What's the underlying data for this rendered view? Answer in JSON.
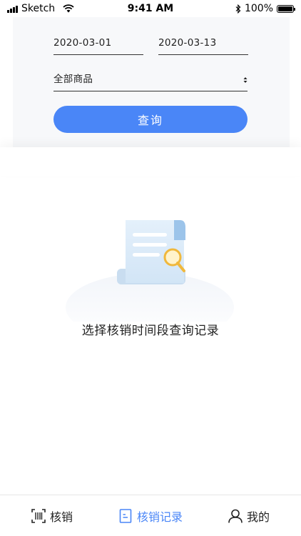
{
  "status_bar": {
    "carrier": "Sketch",
    "time": "9:41 AM",
    "battery": "100%"
  },
  "filter": {
    "start_date": "2020-03-01",
    "end_date": "2020-03-13",
    "product_select": "全部商品",
    "query_button": "查询"
  },
  "empty_state": {
    "message": "选择核销时间段查询记录"
  },
  "tab_bar": {
    "tabs": [
      {
        "label": "核销",
        "icon": "scan-icon",
        "active": false
      },
      {
        "label": "核销记录",
        "icon": "document-icon",
        "active": true
      },
      {
        "label": "我的",
        "icon": "user-icon",
        "active": false
      }
    ]
  },
  "colors": {
    "primary": "#4a86f7",
    "card_bg": "#f7f8fa"
  }
}
